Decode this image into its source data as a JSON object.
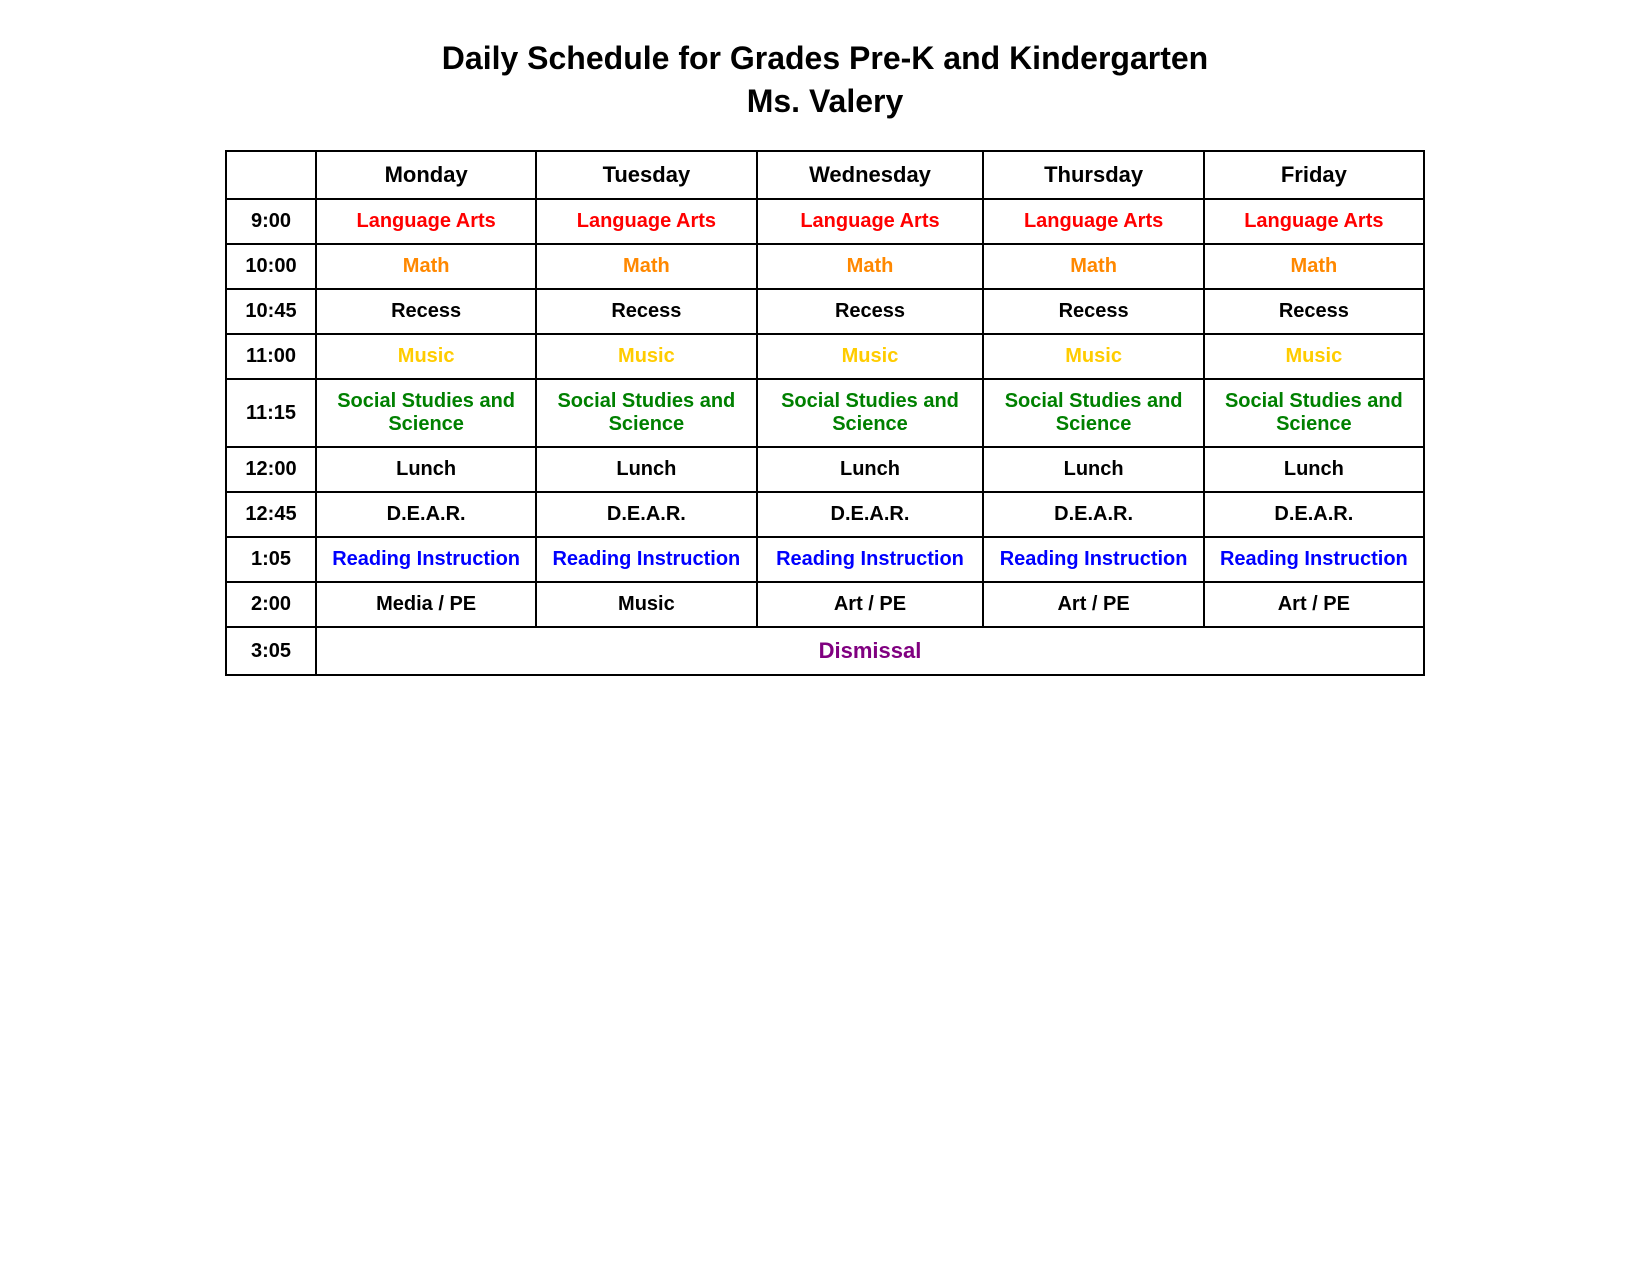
{
  "title": {
    "line1": "Daily Schedule for Grades Pre-K and Kindergarten",
    "line2": "Ms. Valery"
  },
  "columns": {
    "time": "",
    "monday": "Monday",
    "tuesday": "Tuesday",
    "wednesday": "Wednesday",
    "thursday": "Thursday",
    "friday": "Friday"
  },
  "rows": [
    {
      "time": "9:00",
      "subject": "Language Arts",
      "colorClass": "language-arts"
    },
    {
      "time": "10:00",
      "subject": "Math",
      "colorClass": "math"
    },
    {
      "time": "10:45",
      "subject": "Recess",
      "colorClass": "recess"
    },
    {
      "time": "11:00",
      "subject": "Music",
      "colorClass": "music"
    },
    {
      "time": "11:15",
      "subject": "Social Studies and Science",
      "colorClass": "social-studies"
    },
    {
      "time": "12:00",
      "subject": "Lunch",
      "colorClass": "lunch"
    },
    {
      "time": "12:45",
      "subject": "D.E.A.R.",
      "colorClass": "dear"
    },
    {
      "time": "1:05",
      "subject": "Reading Instruction",
      "colorClass": "reading"
    },
    {
      "time": "2:00",
      "subjects": [
        "Media / PE",
        "Music",
        "Art / PE",
        "Art / PE",
        "Art / PE"
      ],
      "colorClass": "media-pe"
    },
    {
      "time": "3:05",
      "subject": "Dismissal",
      "colorClass": "dismissal",
      "colspan": 5
    }
  ]
}
